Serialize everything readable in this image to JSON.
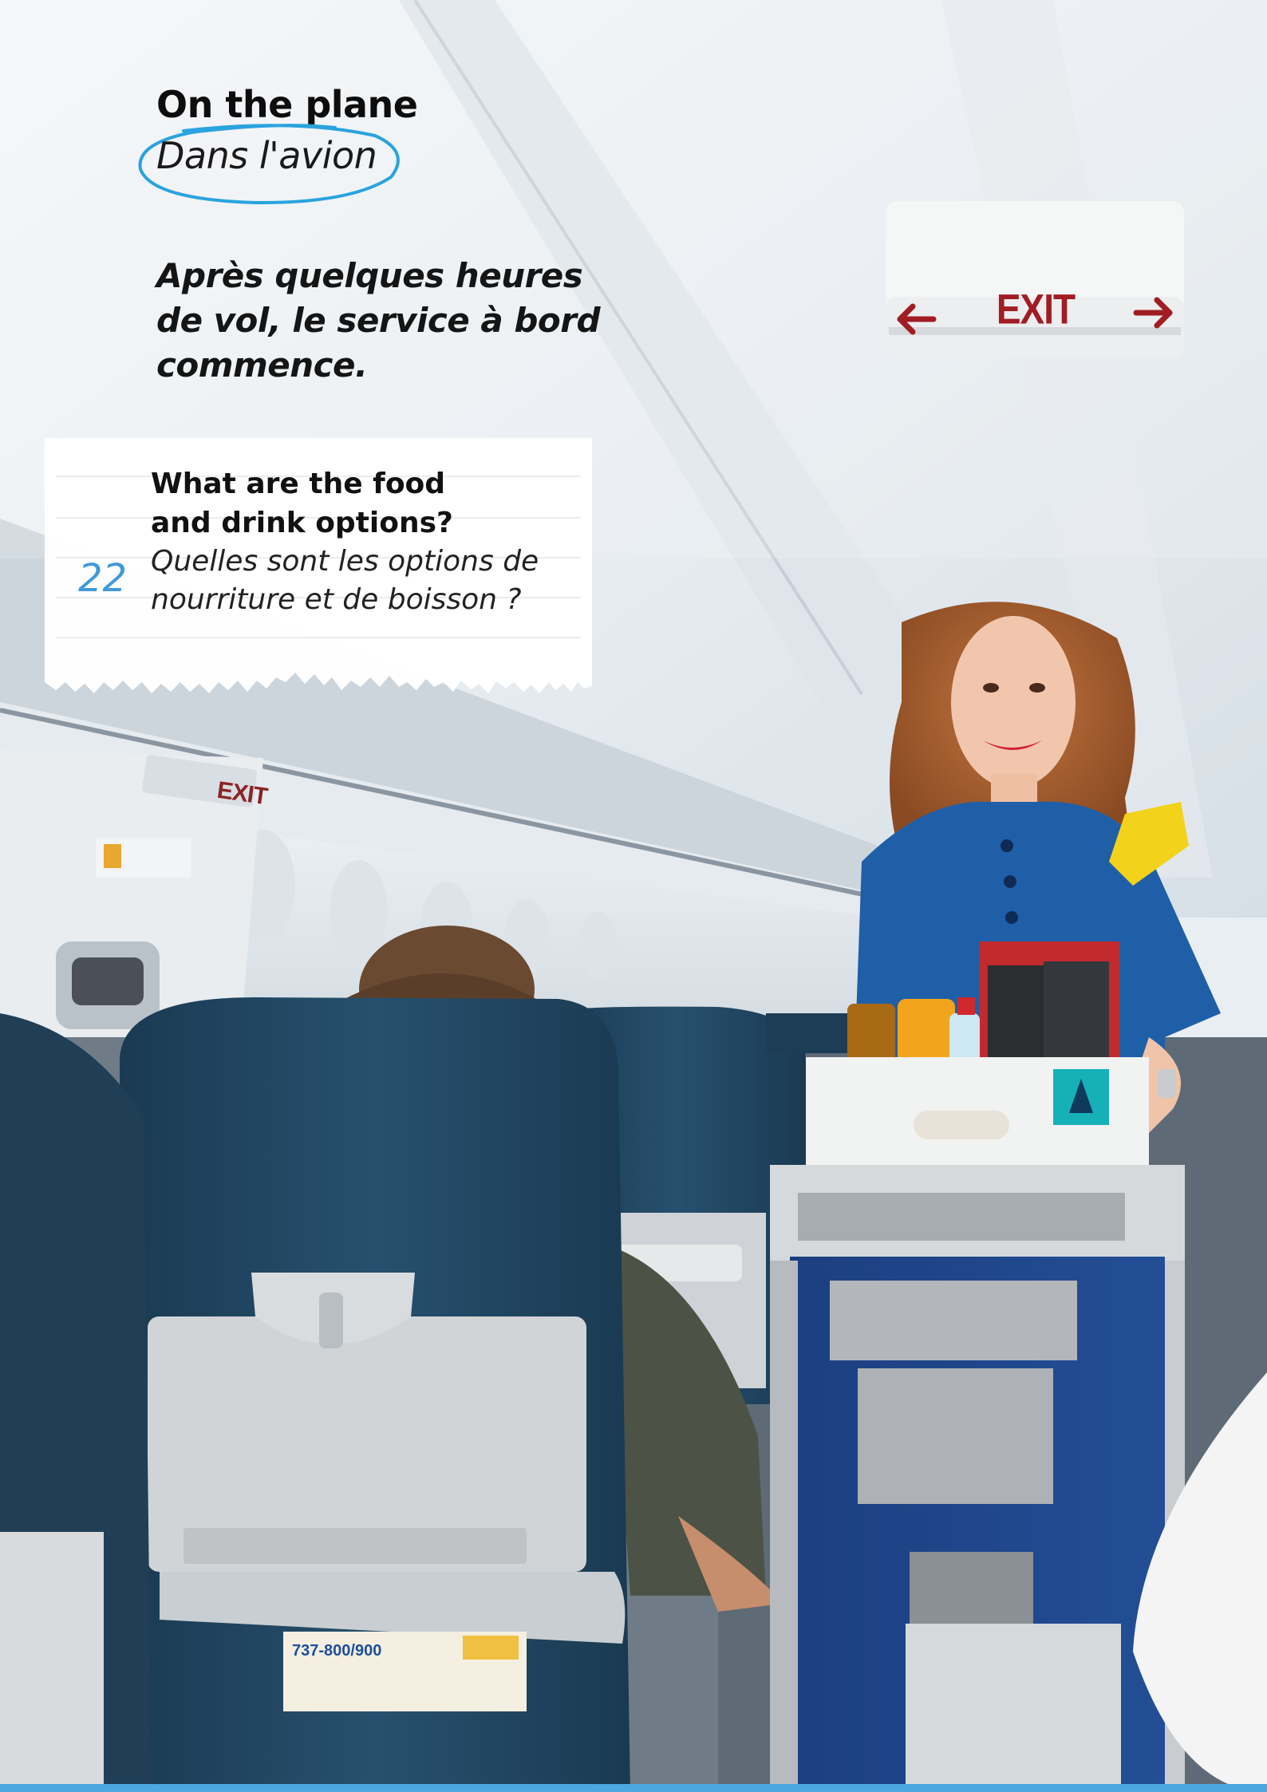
{
  "heading": {
    "title_en": "On the plane",
    "title_fr": "Dans l'avion"
  },
  "intro": "Après quelques heures de vol, le service à bord commence.",
  "question": {
    "number": "22",
    "text_en_line1": "What are the food",
    "text_en_line2": "and drink options?",
    "text_fr_line1": "Quelles sont les options de",
    "text_fr_line2": "nourriture et de boisson ?"
  },
  "photo": {
    "exit_sign": "EXIT",
    "exit_sign_small": "EXIT",
    "seat_card": "737-800/900"
  },
  "colors": {
    "accent_blue": "#3f9ad9",
    "uniform_blue": "#1f5fa8",
    "scarf_yellow": "#f2d21a",
    "exit_red": "#a11d24"
  }
}
